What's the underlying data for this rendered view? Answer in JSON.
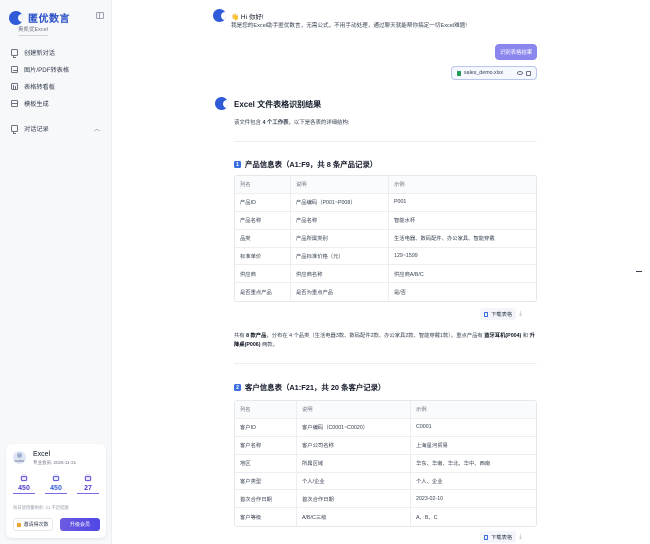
{
  "sidebar": {
    "brand": "匿优数言",
    "workspace": "奥凯优Excel",
    "nav": [
      "创建新对话",
      "图片/PDF转表格",
      "表格转看板",
      "模板生成"
    ],
    "history_label": "对话记录",
    "user": {
      "avatar_label": "avatar",
      "name": "Excel",
      "member": "专业会员: 2026-11-21",
      "stats": [
        "450",
        "450",
        "27"
      ],
      "quota": "每日使用量剩余: 21 不足提醒",
      "invite_label": "邀请得次数",
      "upgrade_label": "升级会员"
    }
  },
  "chat": {
    "greeting_title": "👋 Hi 你好!",
    "greeting_body": "我是您的Excel助手匿优数言，无需公式，不用手动处理，通过聊天就能帮你搞定一切Excel难题!",
    "user_message": "识别表格结果",
    "file_name": "sales_demo.xlsx",
    "result_title": "Excel 文件表格识别结果",
    "result_desc_pre": "该文件包含",
    "result_desc_bold": "4 个工作表",
    "result_desc_post": "，以下是各表的详细结构:",
    "download_label": "下载表格"
  },
  "sections": [
    {
      "num": "1",
      "title": "产品信息表（A1:F9，共 8 条产品记录）",
      "headers": [
        "列名",
        "说明",
        "示例"
      ],
      "rows": [
        [
          "产品ID",
          "产品编码（P001~P008）",
          "P001"
        ],
        [
          "产品名称",
          "产品名称",
          "智能水杯"
        ],
        [
          "品类",
          "产品所属类别",
          "生活电器、数码配件、办公家具、智能穿戴"
        ],
        [
          "标准单价",
          "产品标准价格（元）",
          "129~1599"
        ],
        [
          "供应商",
          "供应商名称",
          "供应商A/B/C"
        ],
        [
          "是否重点产品",
          "是否为重点产品",
          "是/否"
        ]
      ]
    },
    {
      "num": "2",
      "title": "客户信息表（A1:F21，共 20 条客户记录）",
      "headers": [
        "列名",
        "说明",
        "示例"
      ],
      "rows": [
        [
          "客户ID",
          "客户编码（C0001~C0020）",
          "C0001"
        ],
        [
          "客户名称",
          "客户公司名称",
          "上海星河贸易"
        ],
        [
          "地区",
          "所属区域",
          "华东、华南、华北、华中、西南"
        ],
        [
          "客户类型",
          "个人/企业",
          "个人、企业"
        ],
        [
          "首次合作日期",
          "首次合作日期",
          "2023-02-10"
        ],
        [
          "客户等级",
          "A/B/C三级",
          "A、B、C"
        ]
      ]
    }
  ],
  "summary": {
    "p1": "共有",
    "b1": "8 款产品",
    "p2": "，分布在 4 个品类（生活电器3款、数码配件2款、办公家具2款、智能穿戴1款）。重点产品有",
    "b2": "蓝牙耳机(P004)",
    "p3": "和",
    "b3": "升降桌(P006)",
    "p4": "两款。"
  }
}
